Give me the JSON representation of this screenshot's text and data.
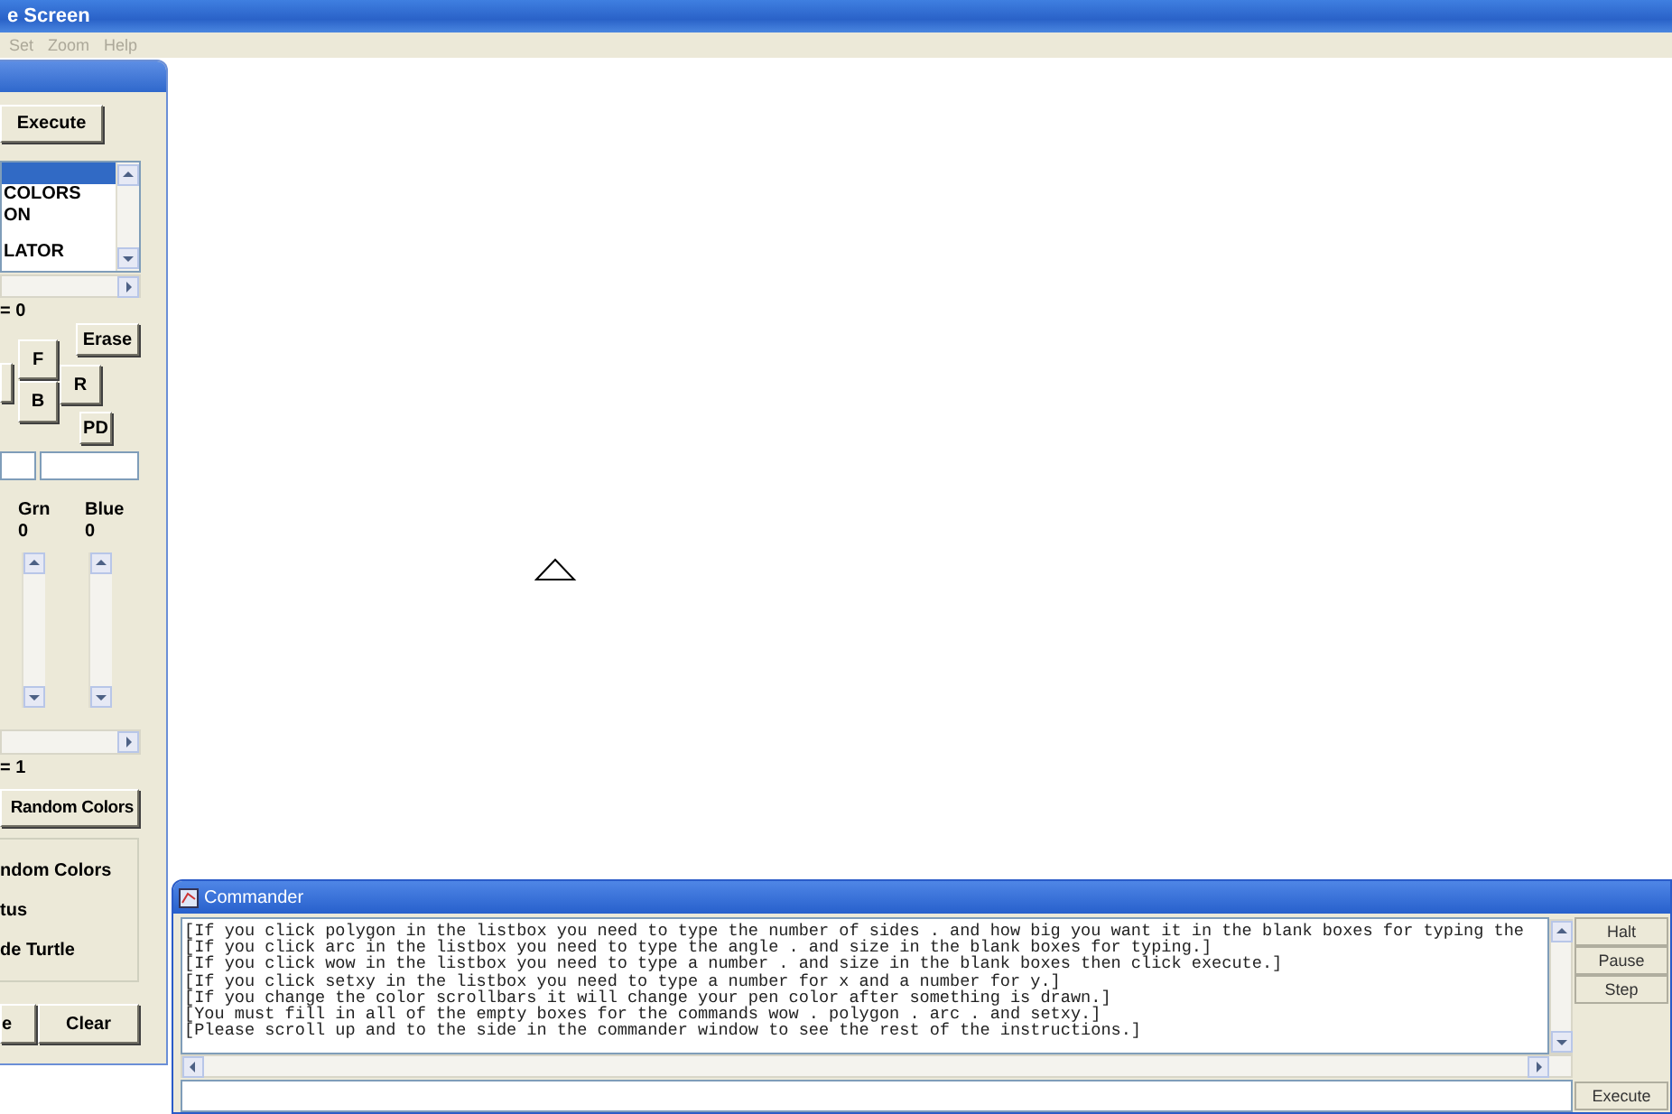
{
  "window": {
    "title": "e Screen"
  },
  "menu": [
    {
      "label": "Set",
      "disabled": true
    },
    {
      "label": "Zoom",
      "disabled": true
    },
    {
      "label": "Help",
      "disabled": true
    }
  ],
  "tool_panel": {
    "execute_button": "Execute",
    "listbox": [
      {
        "selected": true
      },
      {
        "label": "COLORS",
        "selected": false
      },
      {
        "label": "ON",
        "selected": false
      },
      {
        "label": "LATOR",
        "selected": false
      }
    ],
    "readout_1": "= 0",
    "pad_buttons": [
      {
        "label": "Erase"
      },
      {
        "label": "F"
      },
      {
        "label": "R"
      },
      {
        "label": "B"
      },
      {
        "label": "PD"
      }
    ],
    "color_labels": [
      {
        "name": "Grn",
        "value": "0"
      },
      {
        "name": "Blue",
        "value": "0"
      }
    ],
    "readout_2": "= 1",
    "random_button": "Random Colors",
    "options": [
      "ndom Colors",
      "tus",
      "de Turtle"
    ],
    "bottom_buttons": [
      "e",
      "Clear"
    ]
  },
  "commander": {
    "title": "Commander",
    "lines": [
      "[If you click polygon in the listbox you need to type the number of sides . and how big you want it in the blank boxes for typing the",
      "[If you click arc in the listbox you need to type the angle . and size in the blank boxes for typing.]",
      "[If you click wow in the listbox you need to type a number . and size in the blank boxes then click execute.]",
      "[If you click setxy in the listbox you need to type a number for x and a number for y.]",
      "[If you change the color scrollbars it will change your pen color after something is drawn.]",
      "[You must fill in all of the empty boxes for the commands wow . polygon . arc . and setxy.]",
      "[Please scroll up and to the side in the commander window to see the rest of the instructions.]"
    ],
    "side_buttons": [
      "Halt",
      "Pause",
      "Step"
    ],
    "execute_button": "Execute"
  }
}
